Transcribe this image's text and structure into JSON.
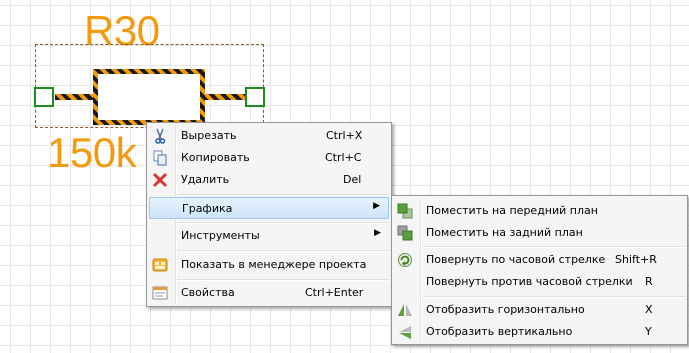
{
  "colors": {
    "label_orange": "#f39a0c",
    "hatch_dark": "#1a1a1a",
    "pin_green": "#1c8c1c",
    "selection_dashed": "#8a5a2a"
  },
  "component": {
    "reference": "R30",
    "value": "150k"
  },
  "context_menu": {
    "items": [
      {
        "label": "Вырезать",
        "shortcut": "Ctrl+X",
        "icon": "scissors-icon"
      },
      {
        "label": "Копировать",
        "shortcut": "Ctrl+C",
        "icon": "copy-icon"
      },
      {
        "label": "Удалить",
        "shortcut": "Del",
        "icon": "delete-icon"
      },
      {
        "label": "Графика",
        "icon": "submenu-arrow-icon"
      },
      {
        "label": "Инструменты",
        "icon": "submenu-arrow-icon"
      },
      {
        "label": "Показать в менеджере проекта",
        "icon": "project-manager-icon"
      },
      {
        "label": "Свойства",
        "shortcut": "Ctrl+Enter",
        "icon": "properties-icon"
      }
    ]
  },
  "graphics_submenu": {
    "items": [
      {
        "label": "Поместить на передний план",
        "icon": "bring-to-front-icon"
      },
      {
        "label": "Поместить на задний план",
        "icon": "send-to-back-icon"
      },
      {
        "label": "Повернуть по часовой стрелке",
        "shortcut": "Shift+R",
        "icon": "rotate-clockwise-icon"
      },
      {
        "label": "Повернуть против часовой стрелки",
        "shortcut": "R"
      },
      {
        "label": "Отобразить горизонтально",
        "shortcut": "X",
        "icon": "flip-horizontal-icon"
      },
      {
        "label": "Отобразить вертикально",
        "shortcut": "Y",
        "icon": "flip-vertical-icon"
      }
    ]
  }
}
